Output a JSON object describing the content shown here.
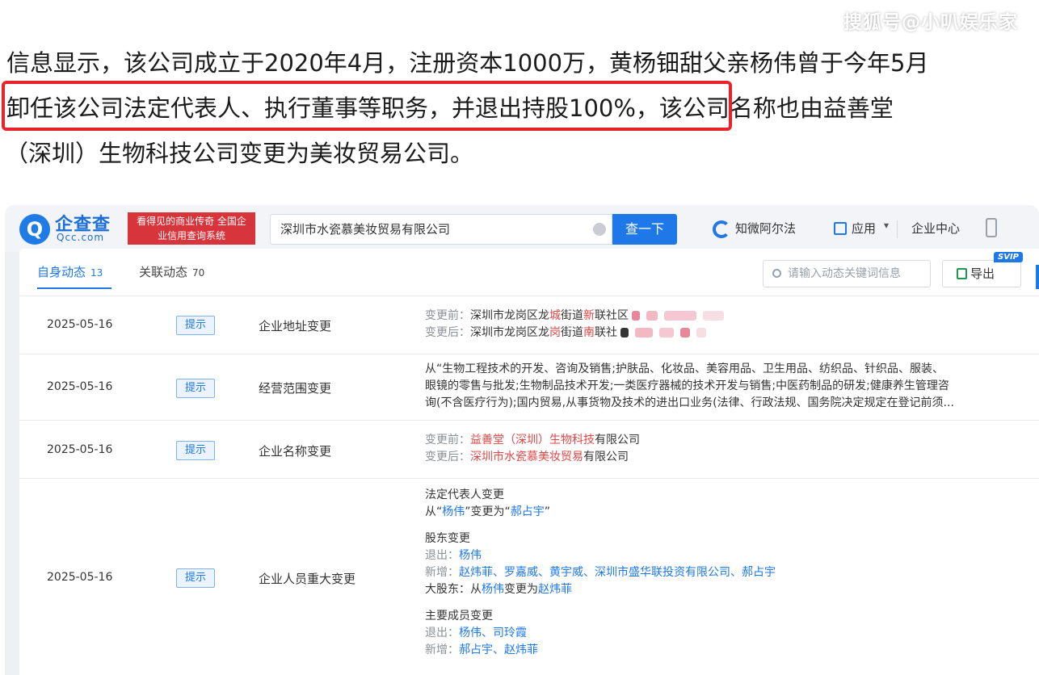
{
  "watermark": "搜狐号@小叭娱乐家",
  "article": {
    "line1": "信息显示，该公司成立于2020年4月，注册资本1000万，黄杨钿甜父亲杨伟曾于今年5月",
    "line2_highlight": "卸任该公司法定代表人、执行董事等职务，并退出持股100%，",
    "line2_rest": "该公司名称也由益善堂",
    "line3": "（深圳）生物科技公司变更为美妆贸易公司。"
  },
  "app": {
    "logo_mark": "Q",
    "logo_text": "企查查",
    "logo_sub": "Qcc.com",
    "slogan": "看得见的商业传奇 全国企业信用查询系统",
    "search_value": "深圳市水瓷慕美妆贸易有限公司",
    "search_button": "查一下",
    "law_label": "知微阿尔法",
    "app_label": "应用",
    "app_chevron": "▾",
    "enterprise_center": "企业中心",
    "accent_color": "#1e78e8",
    "brand_red": "#d8343b"
  },
  "panel": {
    "tabs": [
      {
        "label": "自身动态",
        "count": "13"
      },
      {
        "label": "关联动态",
        "count": "70"
      }
    ],
    "keyword_placeholder": "请输入动态关键词信息",
    "export_label": "导出",
    "svip_label": "SVIP"
  },
  "rows": [
    {
      "date": "2025-05-16",
      "badge": "提示",
      "type": "企业地址变更",
      "before_label": "变更前：",
      "before_a": "深圳市龙岗区龙",
      "before_b": "城",
      "before_c": "街道",
      "before_d": "新",
      "before_e": "联社区",
      "after_label": "变更后：",
      "after_a": "深圳市龙岗区龙",
      "after_b": "岗",
      "after_c": "街道",
      "after_d": "南",
      "after_e": "联社"
    },
    {
      "date": "2025-05-16",
      "badge": "提示",
      "type": "经营范围变更",
      "line1": "从“生物工程技术的开发、咨询及销售;护肤品、化妆品、美容用品、卫生用品、纺织品、针织品、服装、",
      "line2": "眼镜的零售与批发;生物制品技术开发;一类医疗器械的技术开发与销售;中医药制品的研发;健康养生管理咨",
      "line3": "询(不含医疗行为);国内贸易,从事货物及技术的进出口业务(法律、行政法规、国务院决定规定在登记前须..."
    },
    {
      "date": "2025-05-16",
      "badge": "提示",
      "type": "企业名称变更",
      "before_label": "变更前：",
      "before_red": "益善堂（深圳）生物科技",
      "before_rest": "有限公司",
      "after_label": "变更后：",
      "after_red": "深圳市水瓷慕美妆贸易",
      "after_rest": "有限公司"
    },
    {
      "date": "2025-05-16",
      "badge": "提示",
      "type": "企业人员重大变更",
      "legal_title": "法定代表人变更",
      "legal_from": "从“",
      "legal_old": "杨伟",
      "legal_mid": "”变更为“",
      "legal_new": "郝占宇",
      "legal_end": "”",
      "holder_title": "股东变更",
      "exit_label": "退出：",
      "exit_names": "杨伟",
      "add_label": "新增：",
      "add_names": "赵炜菲、罗嘉威、黄宇威、深圳市盛华联投资有限公司、郝占宇",
      "major_label": "大股东：",
      "major_from": "从",
      "major_old": "杨伟",
      "major_mid": "变更为",
      "major_new": "赵炜菲",
      "member_title": "主要成员变更",
      "m_exit_label": "退出：",
      "m_exit_names": "杨伟、司玲霞",
      "m_add_label": "新增：",
      "m_add_names": "郝占宇、赵炜菲"
    }
  ]
}
